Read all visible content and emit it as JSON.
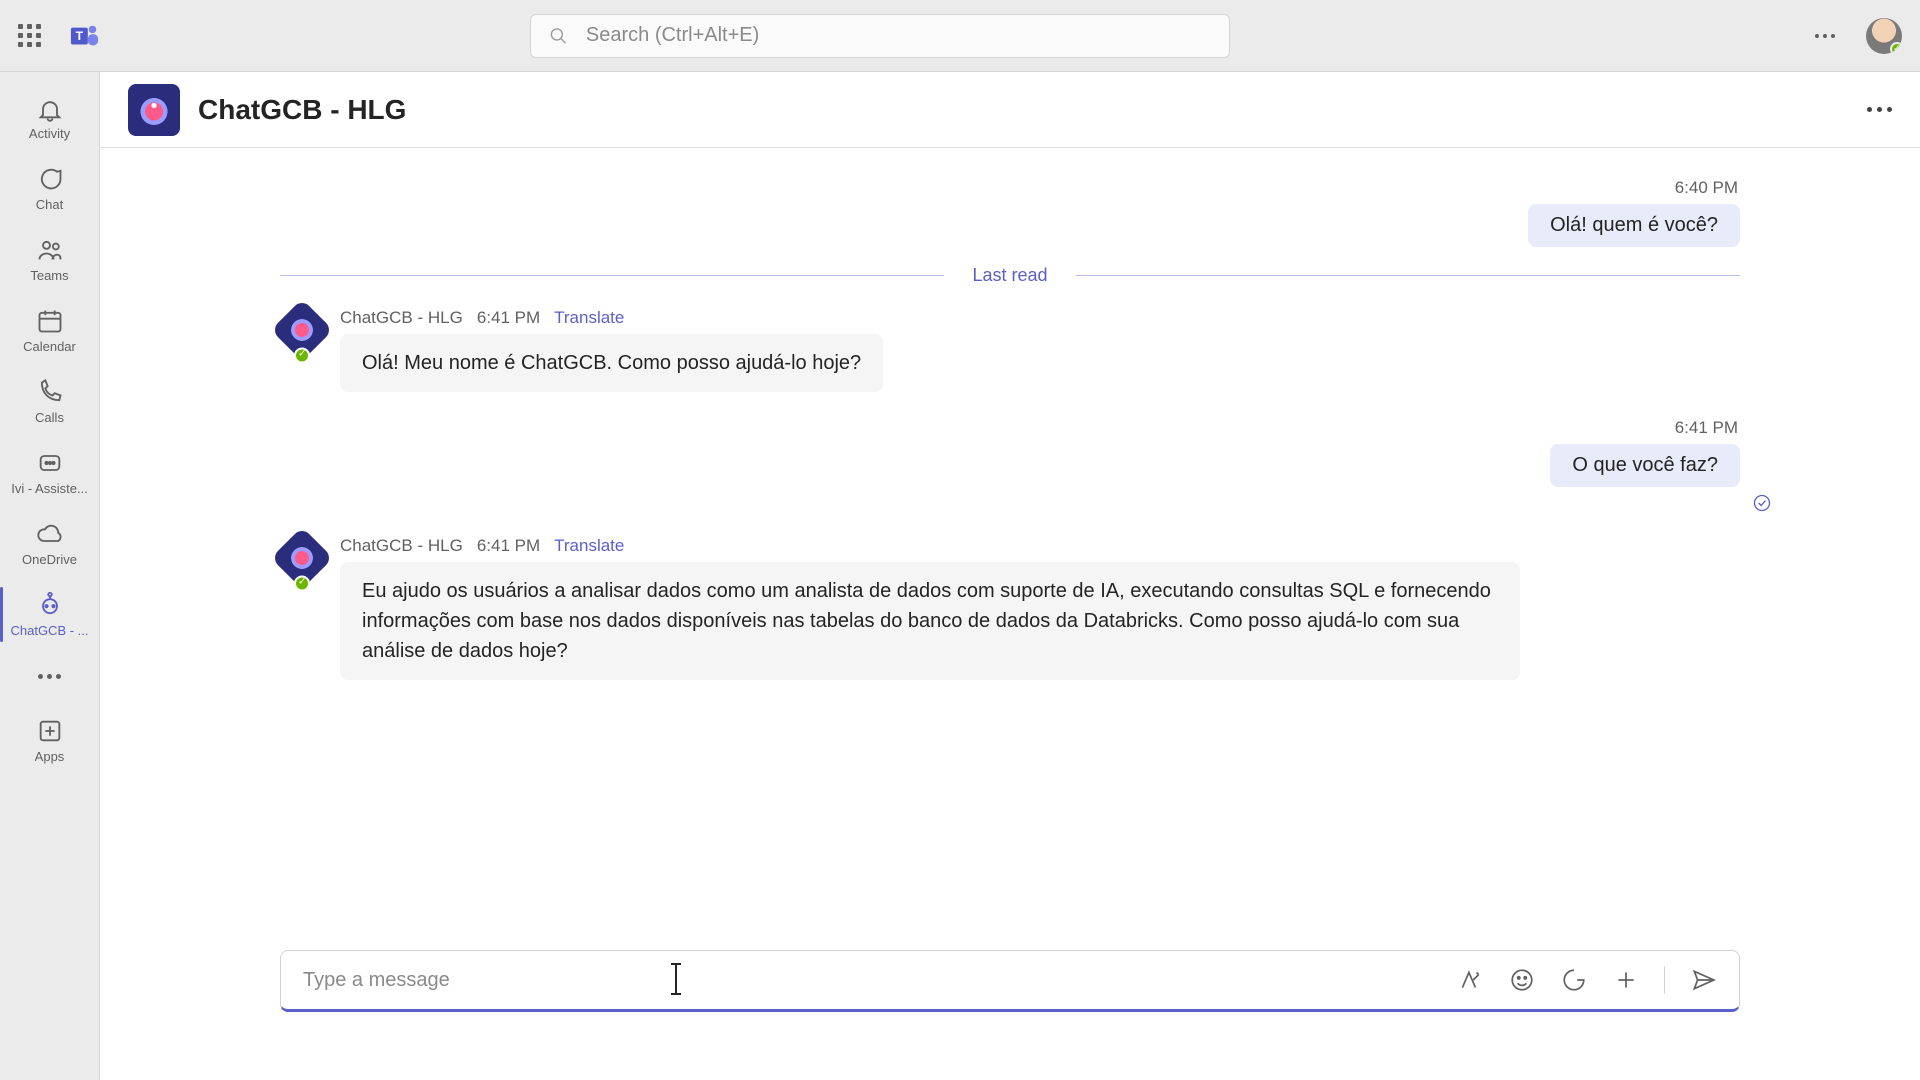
{
  "topbar": {
    "search_placeholder": "Search (Ctrl+Alt+E)"
  },
  "rail": {
    "activity": "Activity",
    "chat": "Chat",
    "teams": "Teams",
    "calendar": "Calendar",
    "calls": "Calls",
    "ivi": "Ivi - Assiste...",
    "onedrive": "OneDrive",
    "chatgcb": "ChatGCB - ...",
    "apps": "Apps"
  },
  "header": {
    "title": "ChatGCB - HLG"
  },
  "divider_label": "Last read",
  "messages": {
    "sent1_time": "6:40 PM",
    "sent1_text": "Olá! quem é você?",
    "bot1_name": "ChatGCB - HLG",
    "bot1_time": "6:41 PM",
    "bot1_translate": "Translate",
    "bot1_text": "Olá! Meu nome é ChatGCB. Como posso ajudá-lo hoje?",
    "sent2_time": "6:41 PM",
    "sent2_text": "O que você faz?",
    "bot2_name": "ChatGCB - HLG",
    "bot2_time": "6:41 PM",
    "bot2_translate": "Translate",
    "bot2_text": "Eu ajudo os usuários a analisar dados como um analista de dados com suporte de IA, executando consultas SQL e fornecendo informações com base nos dados disponíveis nas tabelas do banco de dados da Databricks. Como posso ajudá-lo com sua análise de dados hoje?"
  },
  "composer": {
    "placeholder": "Type a message"
  }
}
